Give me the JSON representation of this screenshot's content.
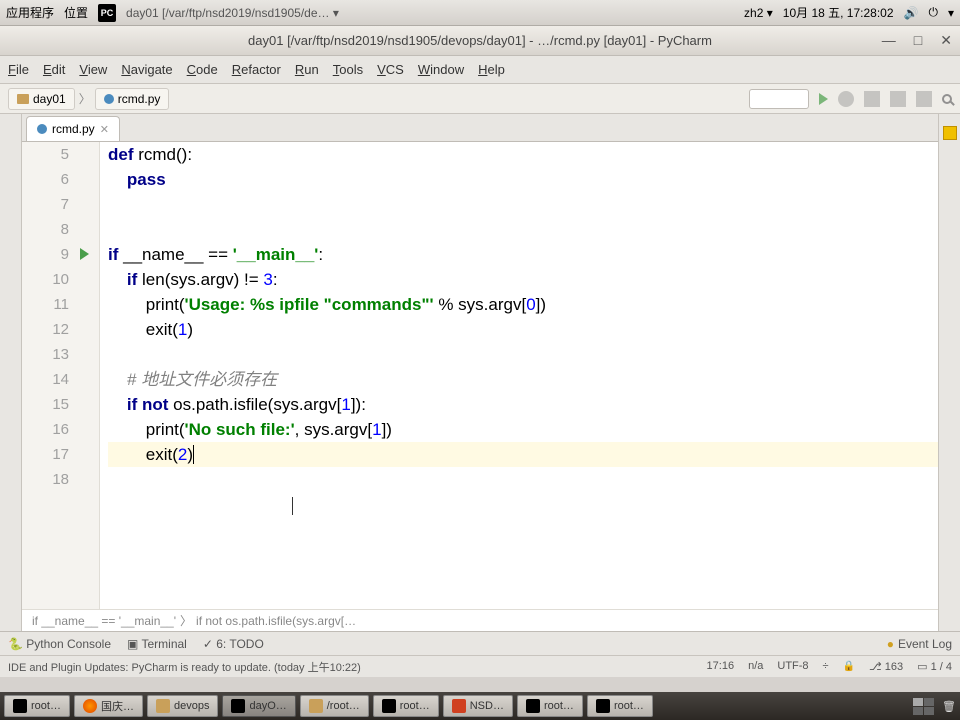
{
  "os_panel": {
    "apps_menu": "应用程序",
    "places_menu": "位置",
    "app_path": "day01 [/var/ftp/nsd2019/nsd1905/de… ▾",
    "ime": "zh2 ▾",
    "date": "10月 18 五, 17:28:02"
  },
  "titlebar": {
    "title": "day01 [/var/ftp/nsd2019/nsd1905/devops/day01] - …/rcmd.py [day01] - PyCharm"
  },
  "menu": {
    "file": "File",
    "edit": "Edit",
    "view": "View",
    "navigate": "Navigate",
    "code": "Code",
    "refactor": "Refactor",
    "run": "Run",
    "tools": "Tools",
    "vcs": "VCS",
    "window": "Window",
    "help": "Help"
  },
  "breadcrumb": {
    "folder": "day01",
    "file": "rcmd.py"
  },
  "tab": {
    "name": "rcmd.py"
  },
  "line_numbers": [
    "5",
    "6",
    "7",
    "8",
    "9",
    "10",
    "11",
    "12",
    "13",
    "14",
    "15",
    "16",
    "17",
    "18"
  ],
  "code": {
    "l5_def": "def ",
    "l5_name": "rcmd():",
    "l6": "pass",
    "l9_if": "if ",
    "l9_rest": "__name__ == ",
    "l9_str": "'__main__'",
    "l9_colon": ":",
    "l10_if": "if ",
    "l10_rest": "len(sys.argv) != ",
    "l10_num": "3",
    "l10_colon": ":",
    "l11_a": "print(",
    "l11_str": "'Usage: %s ipfile \"commands\"'",
    "l11_b": " % sys.argv[",
    "l11_num": "0",
    "l11_c": "])",
    "l12_a": "exit(",
    "l12_num": "1",
    "l12_b": ")",
    "l14": "# 地址文件必须存在",
    "l15_if": "if ",
    "l15_not": "not ",
    "l15_rest": "os.path.isfile(sys.argv[",
    "l15_num": "1",
    "l15_b": "]):",
    "l16_a": "print(",
    "l16_str": "'No such file:'",
    "l16_b": ", sys.argv[",
    "l16_num": "1",
    "l16_c": "])",
    "l17_a": "exit(",
    "l17_num": "2",
    "l17_b": ")"
  },
  "breadcrumb_bottom": {
    "a": "if __name__ == '__main__'",
    "b": "if not os.path.isfile(sys.argv[…"
  },
  "bottom_panel": {
    "python_console": "Python Console",
    "terminal": "Terminal",
    "todo": "6: TODO",
    "event_log": "Event Log"
  },
  "statusbar": {
    "msg": "IDE and Plugin Updates: PyCharm is ready to update. (today 上午10:22)",
    "pos": "17:16",
    "na": "n/a",
    "enc": "UTF-8",
    "sep": "÷",
    "git": "163",
    "stack": "1 / 4"
  },
  "taskbar": {
    "items": [
      "root…",
      "国庆…",
      "devops",
      "dayO…",
      "/root…",
      "root…",
      "NSD…",
      "root…",
      "root…"
    ]
  }
}
